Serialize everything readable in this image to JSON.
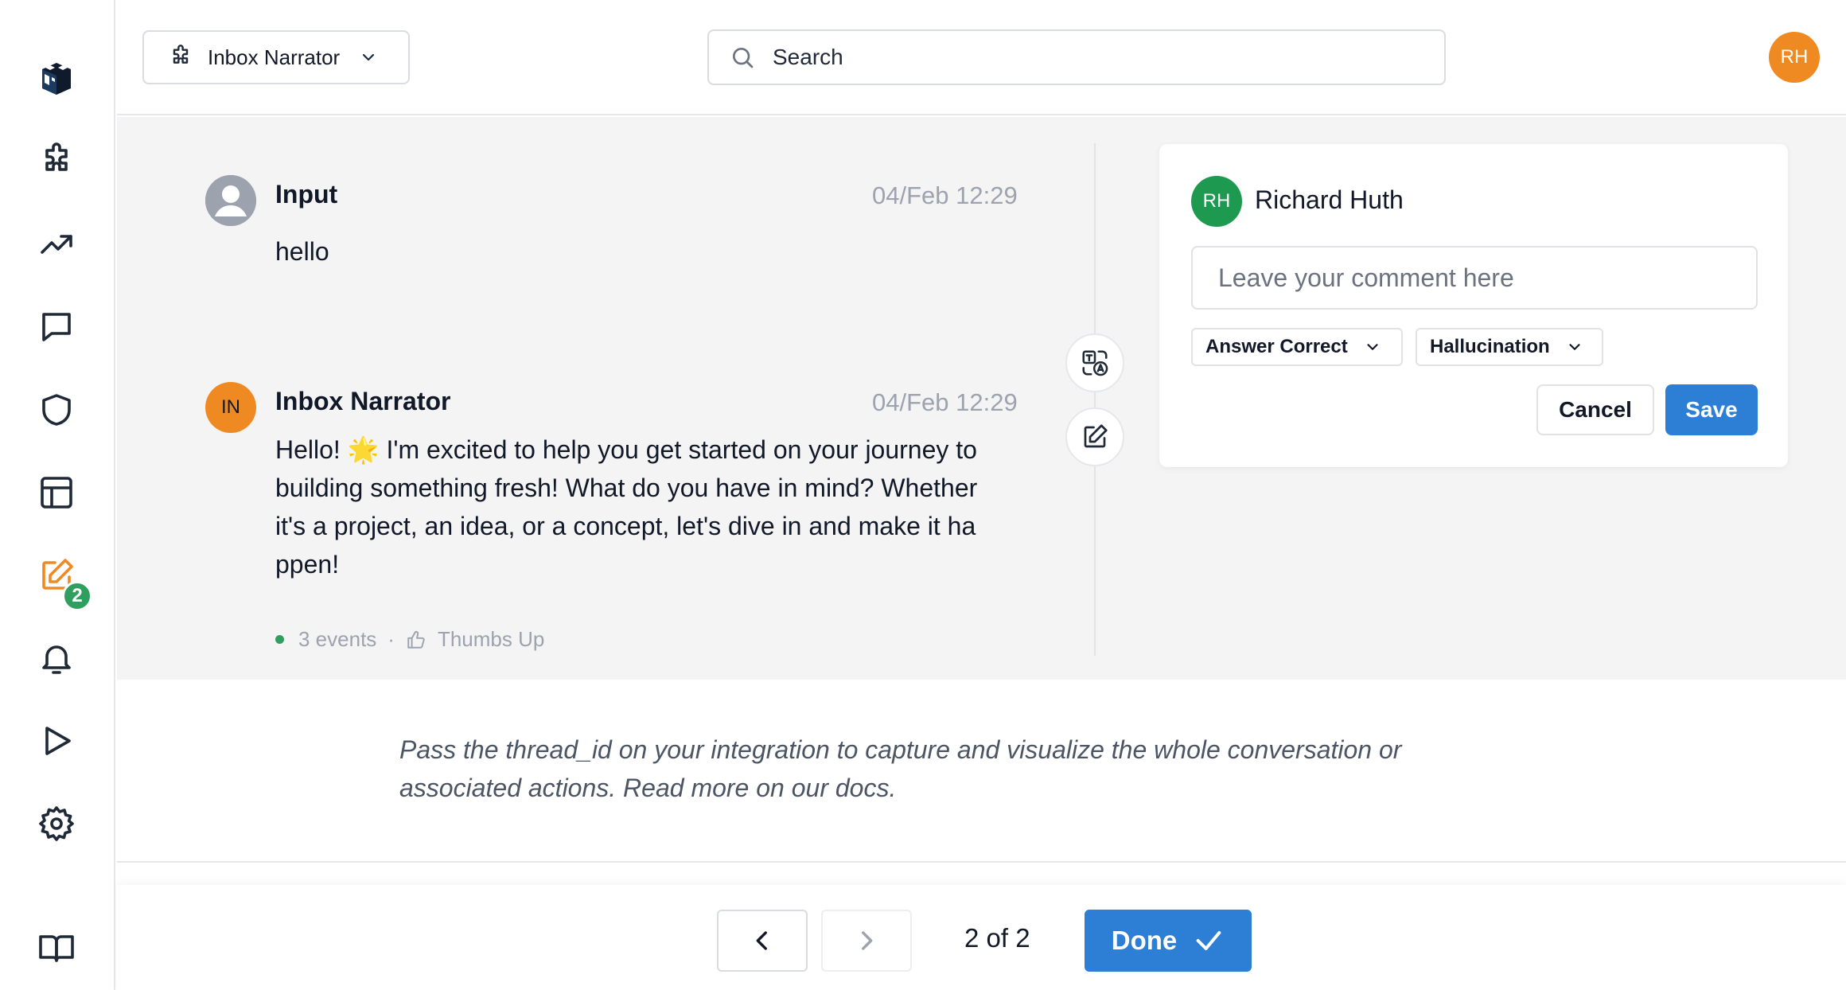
{
  "sidebar": {
    "badge_count": "2"
  },
  "header": {
    "app_selector_label": "Inbox Narrator",
    "search_placeholder": "Search",
    "user_initials": "RH"
  },
  "messages": [
    {
      "author": "Input",
      "timestamp": "04/Feb 12:29",
      "text": "hello"
    },
    {
      "author": "Inbox Narrator",
      "avatar_initials": "IN",
      "timestamp": "04/Feb 12:29",
      "text_lines": [
        "Hello! 🌟 I'm excited to help you get started on your journey to",
        "building something fresh! What do you have in mind? Whether",
        "it's a project, an idea, or a concept, let's dive in and make it ha",
        "ppen!"
      ],
      "events_label": "3 events",
      "feedback_label": "Thumbs Up"
    }
  ],
  "comment_card": {
    "avatar_initials": "RH",
    "user_name": "Richard Huth",
    "comment_placeholder": "Leave your comment here",
    "tag1_label": "Answer Correct",
    "tag2_label": "Hallucination",
    "cancel_label": "Cancel",
    "save_label": "Save"
  },
  "hint": {
    "line1": "Pass the thread_id on your integration to capture and visualize the whole conversation or",
    "line2": "associated actions. Read more on our docs."
  },
  "footer": {
    "pager_text": "2 of 2",
    "done_label": "Done"
  },
  "colors": {
    "accent": "#2d7fd6",
    "user_avatar": "#ef8a22",
    "comment_avatar": "#1d9a50",
    "badge": "#2f9e5e"
  }
}
